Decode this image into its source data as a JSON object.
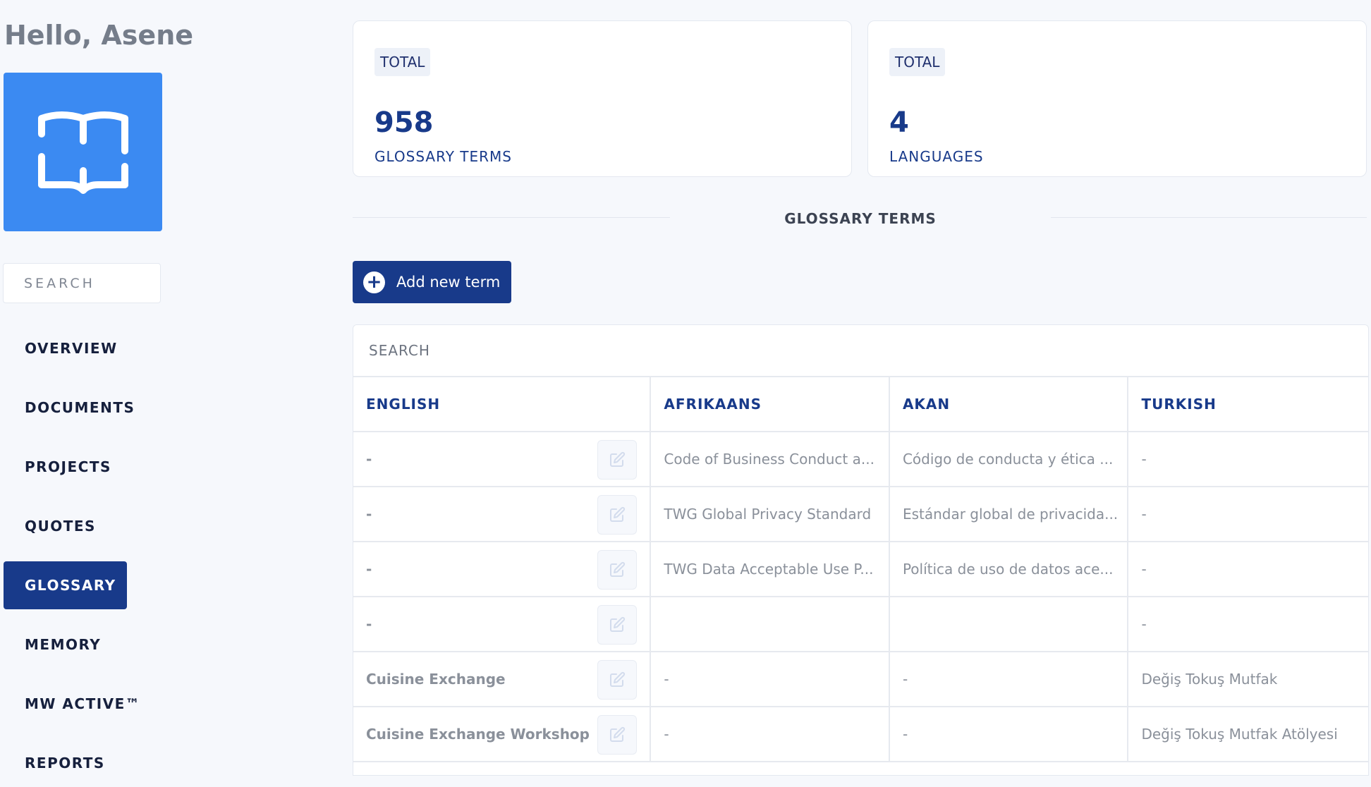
{
  "greeting": "Hello, Asene",
  "sidebar": {
    "logo_icon": "open-book-icon",
    "search_placeholder": "SEARCH",
    "items": [
      {
        "label": "OVERVIEW"
      },
      {
        "label": "DOCUMENTS"
      },
      {
        "label": "PROJECTS"
      },
      {
        "label": "QUOTES"
      },
      {
        "label": "GLOSSARY",
        "active": true
      },
      {
        "label": "MEMORY"
      },
      {
        "label": "MW ACTIVE™"
      },
      {
        "label": "REPORTS"
      }
    ]
  },
  "stats": [
    {
      "badge": "TOTAL",
      "value": "958",
      "label": "GLOSSARY TERMS"
    },
    {
      "badge": "TOTAL",
      "value": "4",
      "label": "LANGUAGES"
    }
  ],
  "section_title": "GLOSSARY TERMS",
  "add_button": {
    "label": "Add new term",
    "icon": "plus-circle-icon"
  },
  "table": {
    "search_placeholder": "SEARCH",
    "columns": [
      "ENGLISH",
      "AFRIKAANS",
      "AKAN",
      "TURKISH"
    ],
    "rows": [
      [
        "-",
        "Code of Business Conduct a...",
        "Código de conducta y ética ...",
        "-"
      ],
      [
        "-",
        "TWG Global Privacy Standard",
        "Estándar global de privacida...",
        "-"
      ],
      [
        "-",
        "TWG Data Acceptable Use P...",
        "Política de uso de datos ace...",
        "-"
      ],
      [
        "-",
        "",
        "",
        "-"
      ],
      [
        "Cuisine Exchange",
        "-",
        "-",
        "Değiş Tokuş Mutfak"
      ],
      [
        "Cuisine Exchange Workshop",
        "-",
        "-",
        "Değiş Tokuş Mutfak Atölyesi"
      ]
    ]
  },
  "colors": {
    "accent": "#183a8a",
    "logo_tile": "#3b8af2",
    "background": "#f6f8fc"
  }
}
